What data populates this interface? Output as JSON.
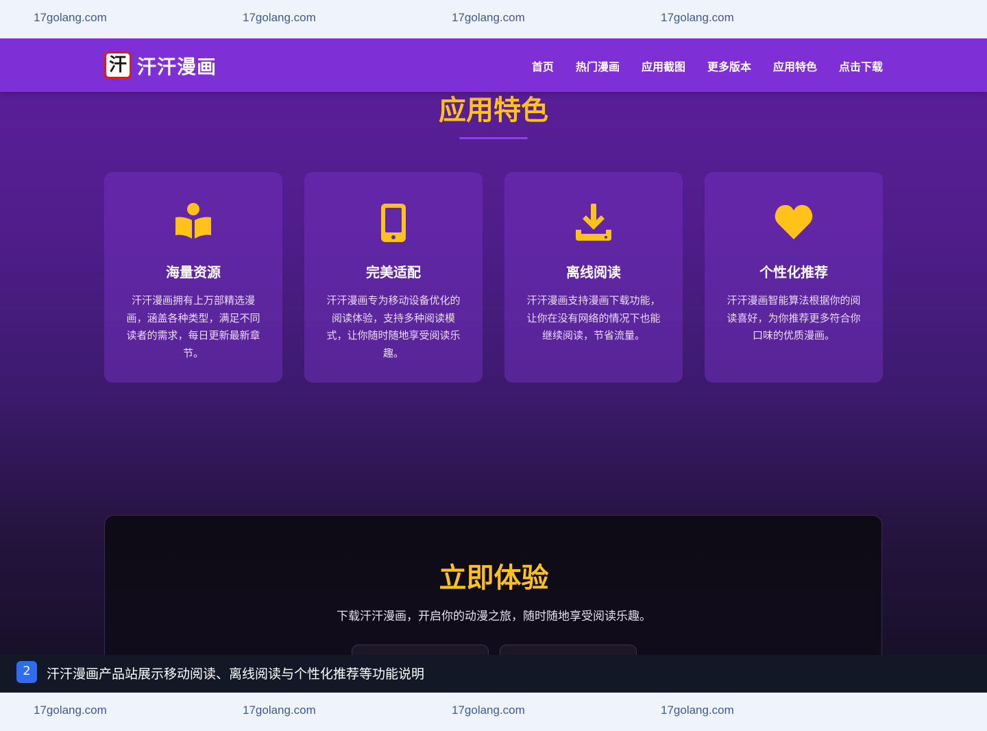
{
  "watermark": {
    "text": "17golang.com",
    "top_items": [
      "17golang.com",
      "17golang.com",
      "17golang.com",
      "17golang.com"
    ],
    "bottom_items": [
      "17golang.com",
      "17golang.com",
      "17golang.com",
      "17golang.com"
    ]
  },
  "header": {
    "logo_char": "汗",
    "brand": "汗汗漫画",
    "nav": [
      "首页",
      "热门漫画",
      "应用截图",
      "更多版本",
      "应用特色",
      "点击下载"
    ]
  },
  "features": {
    "title": "应用特色",
    "cards": [
      {
        "icon": "book-reader-icon",
        "title": "海量资源",
        "desc": "汗汗漫画拥有上万部精选漫画，涵盖各种类型，满足不同读者的需求，每日更新最新章节。"
      },
      {
        "icon": "mobile-phone-icon",
        "title": "完美适配",
        "desc": "汗汗漫画专为移动设备优化的阅读体验，支持多种阅读模式，让你随时随地享受阅读乐趣。"
      },
      {
        "icon": "download-icon",
        "title": "离线阅读",
        "desc": "汗汗漫画支持漫画下载功能，让你在没有网络的情况下也能继续阅读，节省流量。"
      },
      {
        "icon": "heart-icon",
        "title": "个性化推荐",
        "desc": "汗汗漫画智能算法根据你的阅读喜好，为你推荐更多符合你口味的优质漫画。"
      }
    ]
  },
  "cta": {
    "title": "立即体验",
    "desc": "下载汗汗漫画，开启你的动漫之旅，随时随地享受阅读乐趣。"
  },
  "caption": {
    "number": "2",
    "text": "汗汗漫画产品站展示移动阅读、离线阅读与个性化推荐等功能说明"
  },
  "colors": {
    "nav": "#7e2fd6",
    "accent": "#ffc21a",
    "underline": "#8a3ff0"
  }
}
